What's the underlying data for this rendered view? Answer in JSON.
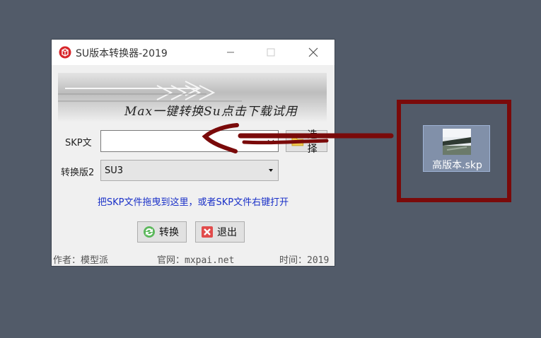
{
  "window": {
    "title": "SU版本转换器-2019",
    "banner_text": "Max一键转换Su点击下载试用",
    "skp_label": "SKP文",
    "skp_value": "",
    "choose_button": "选择",
    "version_label": "转换版2",
    "version_value": "SU3",
    "hint": "把SKP文件拖曳到这里，或者SKP文件右键打开",
    "convert_button": "转换",
    "exit_button": "退出",
    "footer_author": "作者：模型派",
    "footer_site": "官网：mxpai.net",
    "footer_time": "时间：2019"
  },
  "desktop": {
    "file_icon_label": "高版本.skp"
  },
  "colors": {
    "desktop_bg": "#525b69",
    "annotation": "#7a0a0a",
    "hint_text": "#1a30c8"
  }
}
